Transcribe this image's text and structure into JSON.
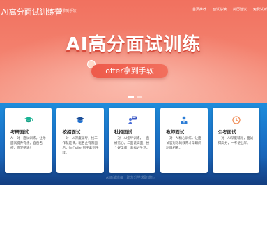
{
  "header": {
    "brand": "AI高分面试训练营",
    "slogan": "Offer拿到手软",
    "nav": [
      "首页推荐",
      "面试必读",
      "简历建议",
      "免费试听"
    ]
  },
  "hero": {
    "headline": "AI高分面试训练",
    "pill": "offer拿到手软",
    "slide_count": 2,
    "active_slide": 1
  },
  "band": {
    "watermark": "AI面试准备 · 助力升学求职成功"
  },
  "cards": [
    {
      "icon": "graduation-cap-icon",
      "title": "考研面试",
      "desc": "AI一对一面试训练，让你面试提升有余，直击名校，圆梦研途！",
      "color": "#1ab394"
    },
    {
      "icon": "mortarboard-icon",
      "title": "校招面试",
      "desc": "一对一AI深度辅导，找工作就是快，驱名企有限面后，你们offer到手拿到手软。",
      "color": "#1b6fd1"
    },
    {
      "icon": "chat-user-icon",
      "title": "社招面试",
      "desc": "一对一AI指导训练，一直被信心，二面说高面，换个好工作，幸福好生活。",
      "color": "#3d58c4"
    },
    {
      "icon": "teacher-icon",
      "title": "教师面试",
      "desc": "一对一AI精心训练，让面试官对你的教育才华瞬间刮目相看。",
      "color": "#2a7cd6"
    },
    {
      "icon": "clock-icon",
      "title": "公考面试",
      "desc": "一对一AI深度辅导，面试得高分，一考便上岸。",
      "color": "#f08c55"
    }
  ],
  "colors": {
    "hero_top": "#f1715f",
    "band": "#1a6ec4",
    "pill": "#ee5a4a"
  }
}
